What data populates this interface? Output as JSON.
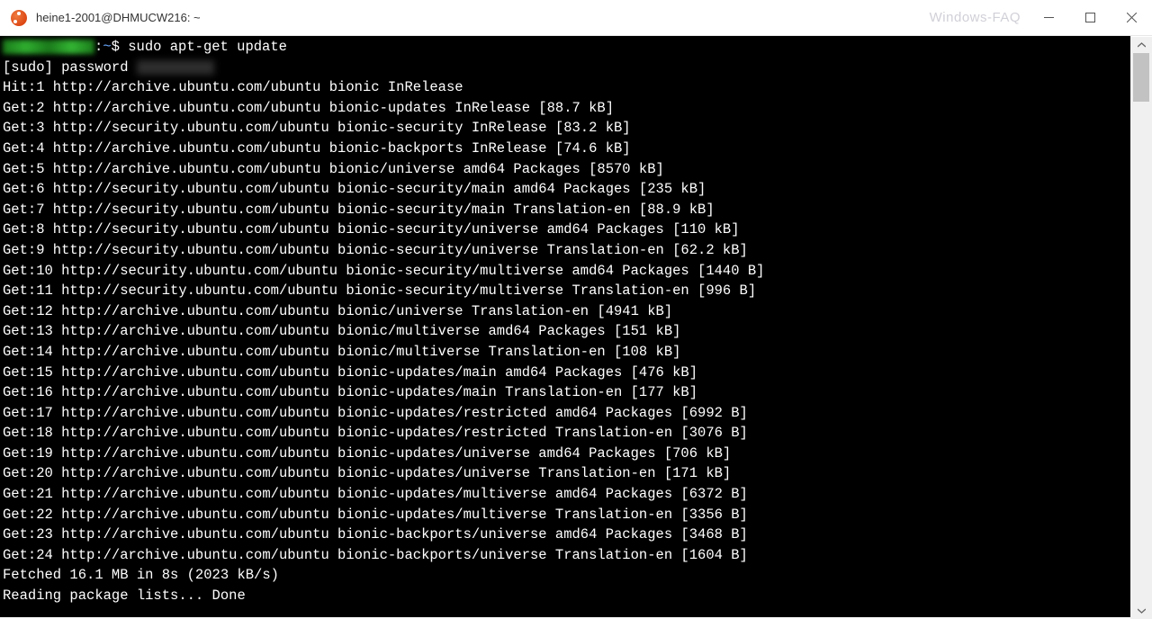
{
  "window": {
    "title": "heine1-2001@DHMUCW216: ~",
    "watermark": "Windows-FAQ"
  },
  "prompt": {
    "user_host": "heine1-2001@DHMUCW216",
    "cwd": "~",
    "command": "sudo apt-get update"
  },
  "password_line_prefix": "[sudo] password ",
  "output_lines": [
    "Hit:1 http://archive.ubuntu.com/ubuntu bionic InRelease",
    "Get:2 http://archive.ubuntu.com/ubuntu bionic-updates InRelease [88.7 kB]",
    "Get:3 http://security.ubuntu.com/ubuntu bionic-security InRelease [83.2 kB]",
    "Get:4 http://archive.ubuntu.com/ubuntu bionic-backports InRelease [74.6 kB]",
    "Get:5 http://archive.ubuntu.com/ubuntu bionic/universe amd64 Packages [8570 kB]",
    "Get:6 http://security.ubuntu.com/ubuntu bionic-security/main amd64 Packages [235 kB]",
    "Get:7 http://security.ubuntu.com/ubuntu bionic-security/main Translation-en [88.9 kB]",
    "Get:8 http://security.ubuntu.com/ubuntu bionic-security/universe amd64 Packages [110 kB]",
    "Get:9 http://security.ubuntu.com/ubuntu bionic-security/universe Translation-en [62.2 kB]",
    "Get:10 http://security.ubuntu.com/ubuntu bionic-security/multiverse amd64 Packages [1440 B]",
    "Get:11 http://security.ubuntu.com/ubuntu bionic-security/multiverse Translation-en [996 B]",
    "Get:12 http://archive.ubuntu.com/ubuntu bionic/universe Translation-en [4941 kB]",
    "Get:13 http://archive.ubuntu.com/ubuntu bionic/multiverse amd64 Packages [151 kB]",
    "Get:14 http://archive.ubuntu.com/ubuntu bionic/multiverse Translation-en [108 kB]",
    "Get:15 http://archive.ubuntu.com/ubuntu bionic-updates/main amd64 Packages [476 kB]",
    "Get:16 http://archive.ubuntu.com/ubuntu bionic-updates/main Translation-en [177 kB]",
    "Get:17 http://archive.ubuntu.com/ubuntu bionic-updates/restricted amd64 Packages [6992 B]",
    "Get:18 http://archive.ubuntu.com/ubuntu bionic-updates/restricted Translation-en [3076 B]",
    "Get:19 http://archive.ubuntu.com/ubuntu bionic-updates/universe amd64 Packages [706 kB]",
    "Get:20 http://archive.ubuntu.com/ubuntu bionic-updates/universe Translation-en [171 kB]",
    "Get:21 http://archive.ubuntu.com/ubuntu bionic-updates/multiverse amd64 Packages [6372 B]",
    "Get:22 http://archive.ubuntu.com/ubuntu bionic-updates/multiverse Translation-en [3356 B]",
    "Get:23 http://archive.ubuntu.com/ubuntu bionic-backports/universe amd64 Packages [3468 B]",
    "Get:24 http://archive.ubuntu.com/ubuntu bionic-backports/universe Translation-en [1604 B]",
    "Fetched 16.1 MB in 8s (2023 kB/s)",
    "Reading package lists... Done"
  ]
}
